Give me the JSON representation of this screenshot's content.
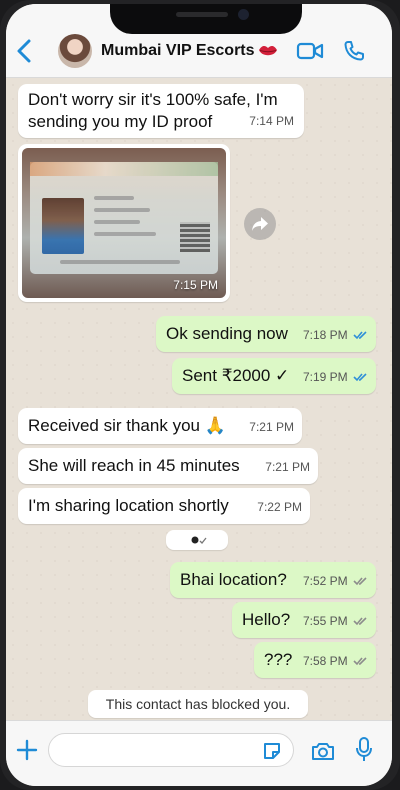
{
  "header": {
    "contact_name": "Mumbai VIP Escorts",
    "icons": [
      "back-chevron-icon",
      "lips-icon",
      "video-call-icon",
      "voice-call-icon"
    ]
  },
  "colors": {
    "accent": "#1f8bd6",
    "incoming_bubble": "#ffffff",
    "outgoing_bubble": "#dcf8c6",
    "chat_background": "#e8e1d7",
    "read_ticks": "#2f8fd8",
    "delivered_ticks": "#8c8c8c"
  },
  "messages": [
    {
      "direction": "in",
      "lines": [
        "Don't worry sir it's 100% safe, I'm",
        "sending you my ID proof"
      ],
      "time": "7:14 PM"
    },
    {
      "direction": "in",
      "type": "image",
      "caption_time": "7:15 PM",
      "image_alt": "ID card photo"
    },
    {
      "direction": "out",
      "text": "Ok sending now",
      "time": "7:18 PM",
      "status": "read"
    },
    {
      "direction": "out",
      "text": "Sent ₹2000 ✓",
      "time": "7:19 PM",
      "status": "read"
    },
    {
      "direction": "in",
      "text": "Received sir thank you 🙏",
      "time": "7:21 PM"
    },
    {
      "direction": "in",
      "text": "She will reach in 45 minutes",
      "time": "7:21 PM"
    },
    {
      "direction": "in",
      "text": "I'm sharing location shortly",
      "time": "7:22 PM"
    },
    {
      "direction": "system",
      "type": "view-once-marker"
    },
    {
      "direction": "out",
      "text": "Bhai location?",
      "time": "7:52 PM",
      "status": "delivered"
    },
    {
      "direction": "out",
      "text": "Hello?",
      "time": "7:55 PM",
      "status": "delivered"
    },
    {
      "direction": "out",
      "text": "???",
      "time": "7:58 PM",
      "status": "delivered"
    }
  ],
  "system_notice": "This contact has blocked you.",
  "composer": {
    "placeholder": "",
    "icons": [
      "plus-icon",
      "sticker-icon",
      "camera-icon",
      "microphone-icon"
    ]
  }
}
